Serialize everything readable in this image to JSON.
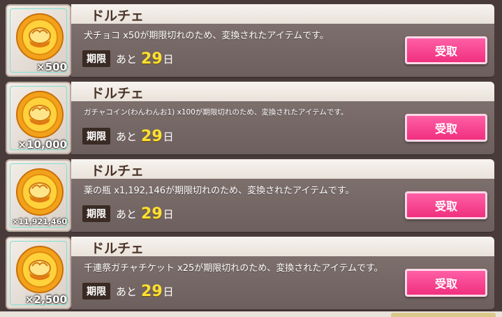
{
  "items": [
    {
      "name": "ドルチェ",
      "message": "犬チョコ x50が期限切れのため、変換されたアイテムです。",
      "quantity": "×500",
      "limit_label": "期限",
      "remaining_prefix": "あと",
      "days": "29",
      "days_unit": "日",
      "button": "受取",
      "icon": "dolce-coin-icon"
    },
    {
      "name": "ドルチェ",
      "message": "ガチャコイン(わんわんお1) x100が期限切れのため、変換されたアイテムです。",
      "quantity": "×10,000",
      "limit_label": "期限",
      "remaining_prefix": "あと",
      "days": "29",
      "days_unit": "日",
      "button": "受取",
      "icon": "dolce-coin-icon"
    },
    {
      "name": "ドルチェ",
      "message": "薬の瓶 x1,192,146が期限切れのため、変換されたアイテムです。",
      "quantity": "×11,921,460",
      "limit_label": "期限",
      "remaining_prefix": "あと",
      "days": "29",
      "days_unit": "日",
      "button": "受取",
      "icon": "dolce-coin-icon"
    },
    {
      "name": "ドルチェ",
      "message": "千連祭ガチャチケット x25が期限切れのため、変換されたアイテムです。",
      "quantity": "×2,500",
      "limit_label": "期限",
      "remaining_prefix": "あと",
      "days": "29",
      "days_unit": "日",
      "button": "受取",
      "icon": "dolce-coin-icon"
    }
  ],
  "colors": {
    "accent_button": "#f0307f",
    "days": "#ffe033",
    "row_body": "#7d6f6c"
  }
}
